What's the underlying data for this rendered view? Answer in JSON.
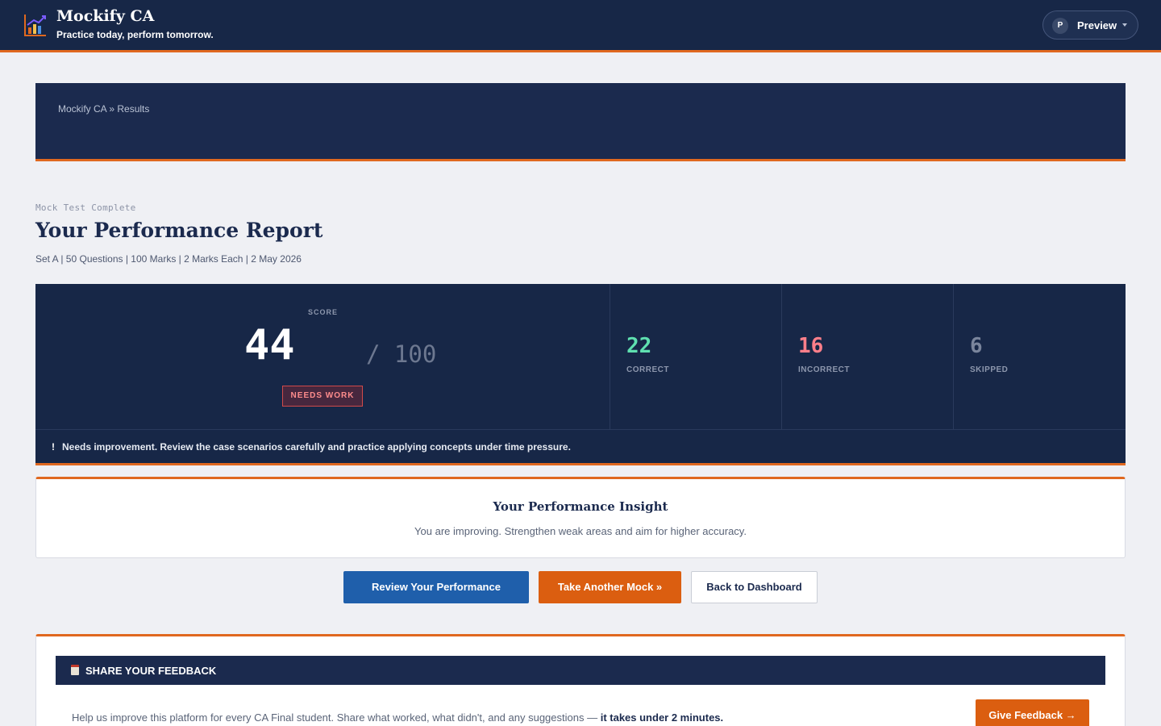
{
  "header": {
    "brand": "Mockify CA",
    "tagline": "Practice today, perform tomorrow.",
    "logo_icon": "bar-chart-icon",
    "user": {
      "avatar_initial": "P",
      "name": "Preview"
    }
  },
  "breadcrumb": "Mockify CA » Results",
  "report": {
    "eyebrow": "Mock Test Complete",
    "title": "Your Performance Report",
    "meta": "Set A | 50 Questions | 100 Marks | 2 Marks Each | 2 May 2026"
  },
  "score": {
    "label": "SCORE",
    "value": "44",
    "total": "/ 100",
    "status_badge": "NEEDS WORK",
    "stats": [
      {
        "value": "22",
        "label": "CORRECT",
        "color": "#5fe0b0"
      },
      {
        "value": "16",
        "label": "INCORRECT",
        "color": "#ff7f8a"
      },
      {
        "value": "6",
        "label": "SKIPPED",
        "color": "#7a859c"
      }
    ],
    "note_icon": "!",
    "note": "Needs improvement. Review the case scenarios carefully and practice applying concepts under time pressure."
  },
  "insight": {
    "title": "Your Performance Insight",
    "text": "You are improving. Strengthen weak areas and aim for higher accuracy."
  },
  "actions": {
    "review": "Review Your Performance",
    "mock": "Take Another Mock »",
    "dashboard": "Back to Dashboard"
  },
  "feedback": {
    "title": "SHARE YOUR FEEDBACK",
    "icon": "clipboard-icon",
    "text": "Help us improve this platform for every CA Final student. Share what worked, what didn't, and any suggestions — ",
    "text_strong": "it takes under 2 minutes.",
    "button": "Give Feedback →"
  },
  "colors": {
    "navy": "#172747",
    "accent_orange": "#e0681f",
    "primary_blue": "#1f5fab"
  }
}
